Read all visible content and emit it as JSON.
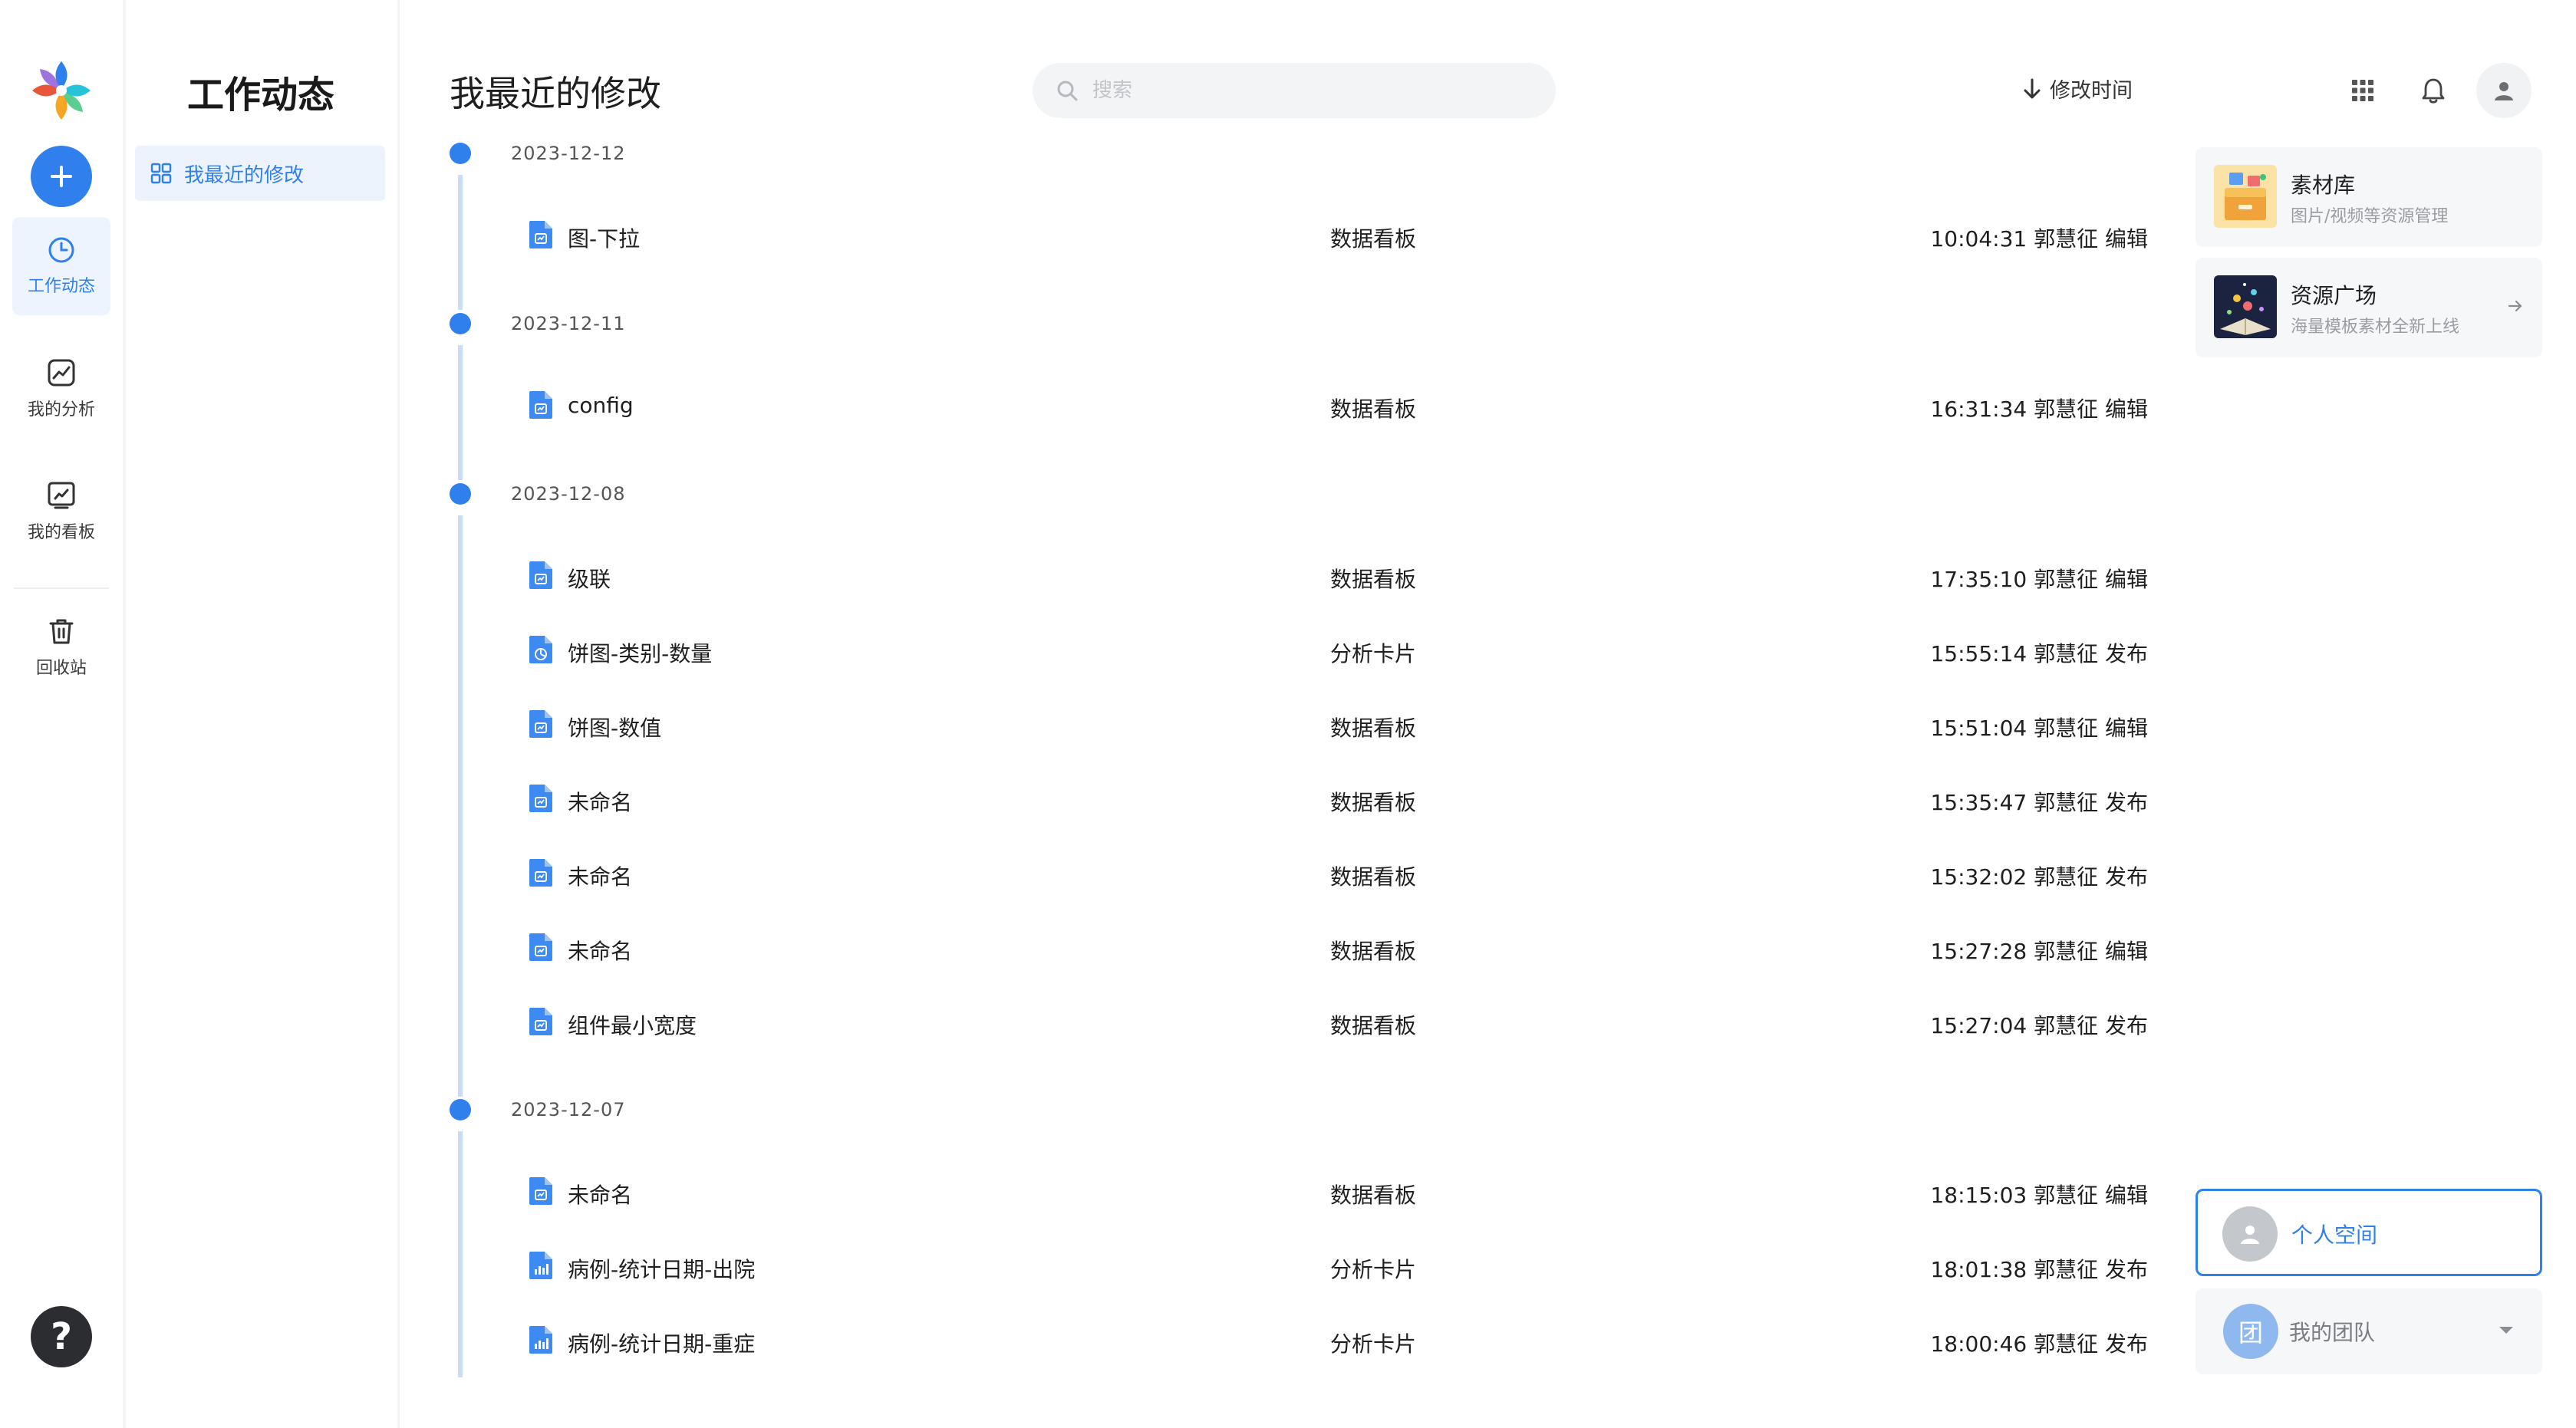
{
  "rail": {
    "items": [
      {
        "label": "工作动态",
        "icon": "clock-icon"
      },
      {
        "label": "我的分析",
        "icon": "chart-line-icon"
      },
      {
        "label": "我的看板",
        "icon": "dashboard-icon"
      },
      {
        "label": "回收站",
        "icon": "trash-icon"
      }
    ],
    "help": "?"
  },
  "sidebar": {
    "title": "工作动态",
    "item": "我最近的修改"
  },
  "header": {
    "title": "我最近的修改",
    "search_placeholder": "搜索",
    "sort_label": "修改时间"
  },
  "groups": [
    {
      "date": "2023-12-12",
      "items": [
        {
          "name": "图-下拉",
          "type": "数据看板",
          "time": "10:04:31 郭慧征 编辑",
          "icon": "dashboard-file-icon"
        }
      ]
    },
    {
      "date": "2023-12-11",
      "items": [
        {
          "name": "config",
          "type": "数据看板",
          "time": "16:31:34 郭慧征 编辑",
          "icon": "dashboard-file-icon"
        }
      ]
    },
    {
      "date": "2023-12-08",
      "items": [
        {
          "name": "级联",
          "type": "数据看板",
          "time": "17:35:10 郭慧征 编辑",
          "icon": "dashboard-file-icon"
        },
        {
          "name": "饼图-类别-数量",
          "type": "分析卡片",
          "time": "15:55:14 郭慧征 发布",
          "icon": "pie-file-icon"
        },
        {
          "name": "饼图-数值",
          "type": "数据看板",
          "time": "15:51:04 郭慧征 编辑",
          "icon": "dashboard-file-icon"
        },
        {
          "name": "未命名",
          "type": "数据看板",
          "time": "15:35:47 郭慧征 发布",
          "icon": "dashboard-file-icon"
        },
        {
          "name": "未命名",
          "type": "数据看板",
          "time": "15:32:02 郭慧征 发布",
          "icon": "dashboard-file-icon"
        },
        {
          "name": "未命名",
          "type": "数据看板",
          "time": "15:27:28 郭慧征 编辑",
          "icon": "dashboard-file-icon"
        },
        {
          "name": "组件最小宽度",
          "type": "数据看板",
          "time": "15:27:04 郭慧征 发布",
          "icon": "dashboard-file-icon"
        }
      ]
    },
    {
      "date": "2023-12-07",
      "items": [
        {
          "name": "未命名",
          "type": "数据看板",
          "time": "18:15:03 郭慧征 编辑",
          "icon": "dashboard-file-icon"
        },
        {
          "name": "病例-统计日期-出院",
          "type": "分析卡片",
          "time": "18:01:38 郭慧征 发布",
          "icon": "bar-file-icon"
        },
        {
          "name": "病例-统计日期-重症",
          "type": "分析卡片",
          "time": "18:00:46 郭慧征 发布",
          "icon": "bar-file-icon"
        }
      ]
    }
  ],
  "right_panel": {
    "material": {
      "title": "素材库",
      "subtitle": "图片/视频等资源管理"
    },
    "resource": {
      "title": "资源广场",
      "subtitle": "海量模板素材全新上线"
    },
    "personal_space": "个人空间",
    "team": {
      "badge": "团",
      "label": "我的团队"
    }
  },
  "colors": {
    "accent": "#2f80ed",
    "timeline": "#c9dcf8",
    "active_bg": "#edf3fc"
  }
}
